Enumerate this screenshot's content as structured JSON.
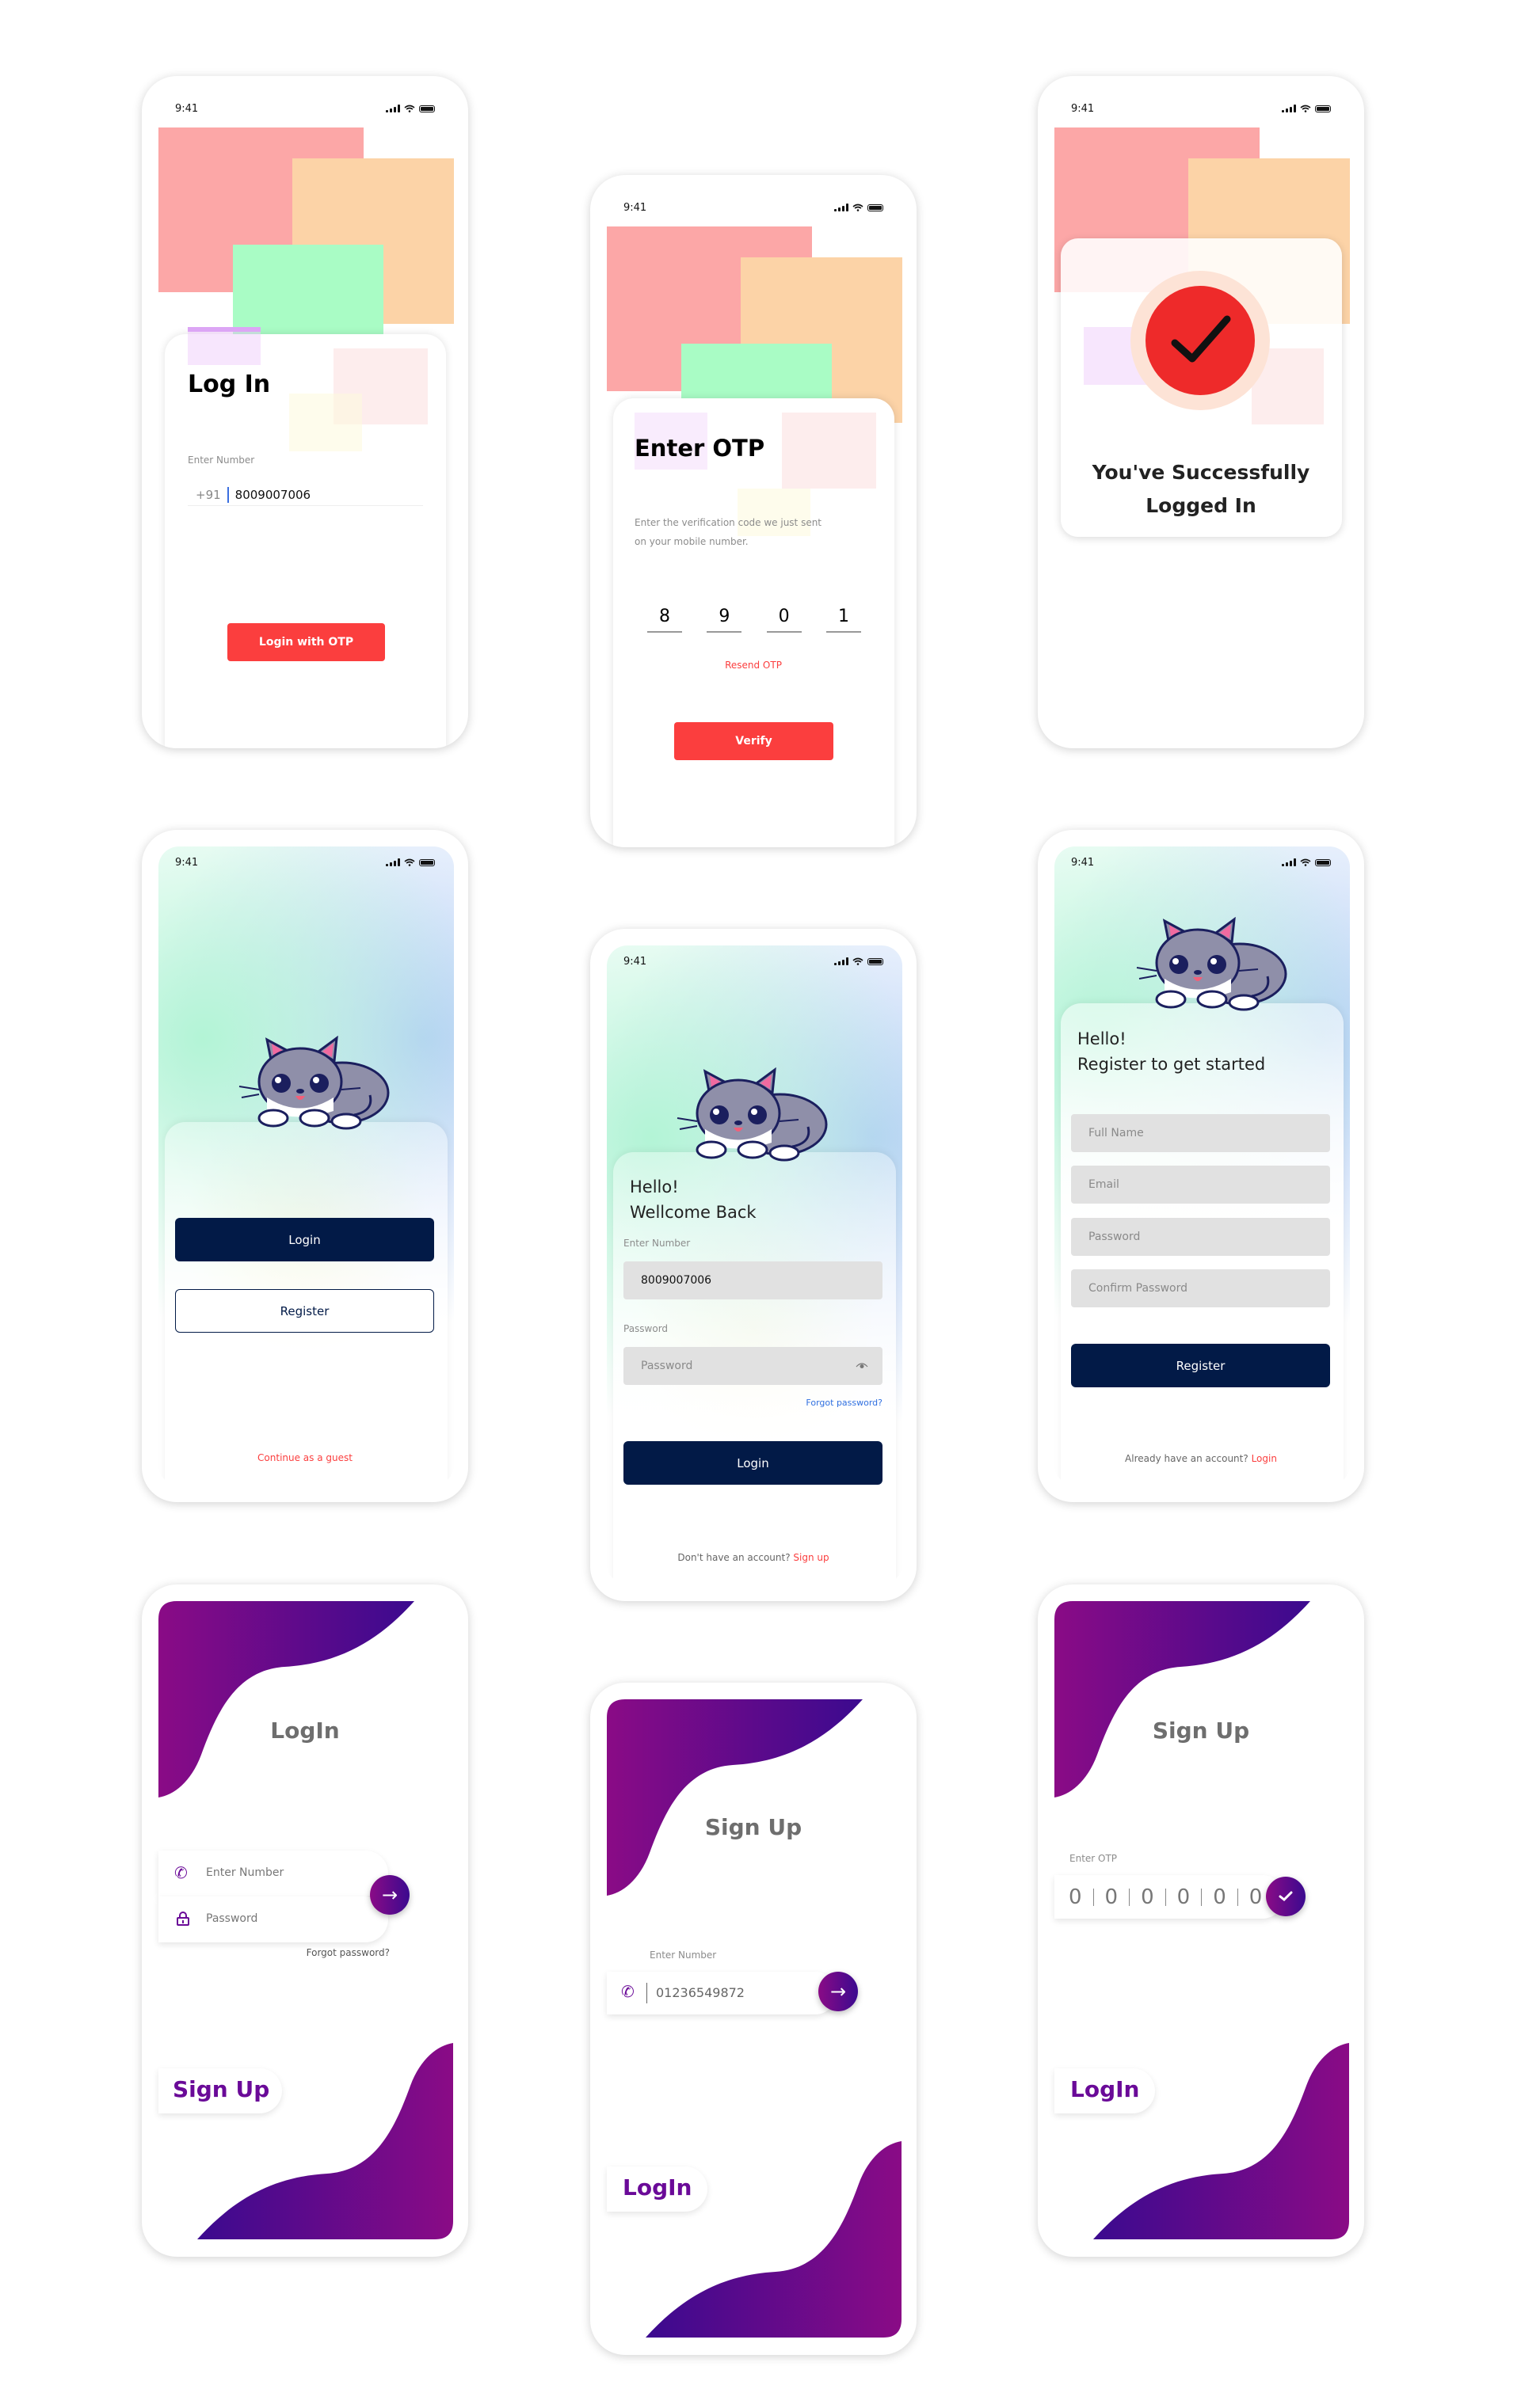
{
  "status_time": "9:41",
  "colors": {
    "red": "#fb3e3e",
    "navy": "#021a47",
    "purple_start": "#8a0b86",
    "purple_end": "#3b0a8f",
    "link_blue": "#2f6fe0"
  },
  "otp_login": {
    "title": "Log In",
    "number_label": "Enter Number",
    "country_code": "+91",
    "number_value": "8009007006",
    "button": "Login with OTP"
  },
  "otp_verify": {
    "title": "Enter OTP",
    "description_line1": "Enter the verification code we just sent",
    "description_line2": "on your mobile number.",
    "digits": [
      "8",
      "9",
      "0",
      "1"
    ],
    "resend": "Resend OTP",
    "button": "Verify"
  },
  "success": {
    "icon": "check-icon",
    "line1": "You've Successfully",
    "line2": "Logged In"
  },
  "landing": {
    "login_button": "Login",
    "register_button": "Register",
    "guest_link": "Continue as a guest"
  },
  "welcome": {
    "greeting": "Hello!",
    "subtitle": "Wellcome Back",
    "number_label": "Enter Number",
    "number_value": "8009007006",
    "password_label": "Password",
    "password_placeholder": "Password",
    "forgot": "Forgot password?",
    "button": "Login",
    "footer_text": "Don't have an account?",
    "footer_link": "Sign up"
  },
  "register": {
    "greeting": "Hello!",
    "subtitle": "Register to get started",
    "fields": [
      "Full Name",
      "Email",
      "Password",
      "Confirm Password"
    ],
    "button": "Register",
    "footer_text": "Already have an account?",
    "footer_link": "Login"
  },
  "purple_login": {
    "title": "LogIn",
    "number_placeholder": "Enter Number",
    "password_placeholder": "Password",
    "forgot": "Forgot password?",
    "switch_link": "Sign Up"
  },
  "purple_signup": {
    "title": "Sign Up",
    "number_label": "Enter Number",
    "number_value": "01236549872",
    "switch_link": "LogIn"
  },
  "purple_otp": {
    "title": "Sign Up",
    "otp_label": "Enter OTP",
    "digits": [
      "0",
      "0",
      "0",
      "0",
      "0",
      "0"
    ],
    "switch_link": "LogIn"
  }
}
